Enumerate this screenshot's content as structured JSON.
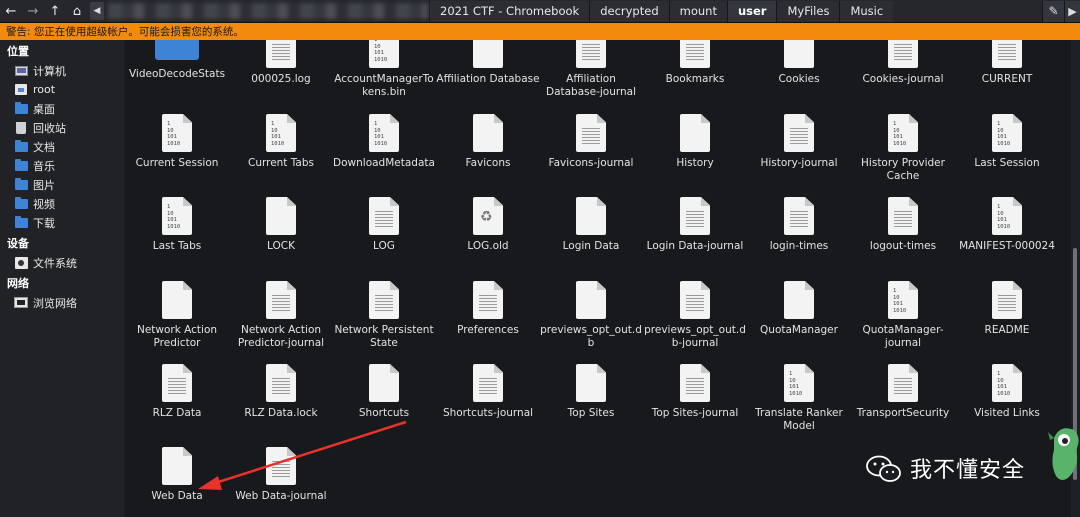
{
  "toolbar": {
    "back_icon": "arrow-left",
    "forward_icon": "arrow-right",
    "up_icon": "arrow-up",
    "home_icon": "home",
    "toggle_icon": "chevron-left",
    "breadcrumbs": [
      "2021 CTF - Chromebook",
      "decrypted",
      "mount",
      "user",
      "MyFiles",
      "Music"
    ],
    "active_crumb": "user",
    "edit_icon": "pencil",
    "menu_icon": "chevron-right"
  },
  "warning": {
    "text": "警告: 您正在使用超级帐户。可能会损害您的系统。",
    "color": "#f28a0e"
  },
  "sidebar": {
    "places_title": "位置",
    "places": [
      {
        "label": "计算机",
        "icon": "monitor-icon"
      },
      {
        "label": "root",
        "icon": "home-icon"
      },
      {
        "label": "桌面",
        "icon": "folder-icon"
      },
      {
        "label": "回收站",
        "icon": "trash-icon"
      },
      {
        "label": "文档",
        "icon": "folder-icon"
      },
      {
        "label": "音乐",
        "icon": "folder-icon"
      },
      {
        "label": "图片",
        "icon": "folder-icon"
      },
      {
        "label": "视频",
        "icon": "folder-icon"
      },
      {
        "label": "下载",
        "icon": "folder-icon"
      }
    ],
    "devices_title": "设备",
    "devices": [
      {
        "label": "文件系统",
        "icon": "drive-icon"
      }
    ],
    "network_title": "网络",
    "network": [
      {
        "label": "浏览网络",
        "icon": "network-icon"
      }
    ]
  },
  "files": [
    [
      "VideoDecodeStats",
      "000025.log",
      "AccountManagerTokens.bin",
      "Affiliation Database",
      "Affiliation Database-journal",
      "Bookmarks",
      "Cookies",
      "Cookies-journal",
      "CURRENT"
    ],
    [
      "Current Session",
      "Current Tabs",
      "DownloadMetadata",
      "Favicons",
      "Favicons-journal",
      "History",
      "History-journal",
      "History Provider Cache",
      "Last Session"
    ],
    [
      "Last Tabs",
      "LOCK",
      "LOG",
      "LOG.old",
      "Login Data",
      "Login Data-journal",
      "login-times",
      "logout-times",
      "MANIFEST-000024"
    ],
    [
      "Network Action Predictor",
      "Network Action Predictor-journal",
      "Network Persistent State",
      "Preferences",
      "previews_opt_out.db",
      "previews_opt_out.db-journal",
      "QuotaManager",
      "QuotaManager-journal",
      "README"
    ],
    [
      "RLZ Data",
      "RLZ Data.lock",
      "Shortcuts",
      "Shortcuts-journal",
      "Top Sites",
      "Top Sites-journal",
      "Translate Ranker Model",
      "TransportSecurity",
      "Visited Links"
    ],
    [
      "Web Data",
      "Web Data-journal"
    ]
  ],
  "file_labels_wrapped": {
    "AccountManagerTokens.bin": "AccountManagerTo\nkens.bin",
    "Affiliation Database-journal": "Affiliation\nDatabase-journal",
    "History Provider Cache": "History Provider\nCache",
    "Network Action Predictor": "Network Action\nPredictor",
    "Network Action Predictor-journal": "Network Action\nPredictor-journal",
    "Network Persistent State": "Network Persistent\nState",
    "previews_opt_out.db": "previews_opt_out.d\nb",
    "previews_opt_out.db-journal": "previews_opt_out.d\nb-journal",
    "QuotaManager-journal": "QuotaManager-\njournal",
    "Translate Ranker Model": "Translate Ranker\nModel"
  },
  "icon_types": {
    "VideoDecodeStats": "folder",
    "000025.log": "text",
    "AccountManagerTokens.bin": "binary",
    "Affiliation Database": "blank",
    "Affiliation Database-journal": "text",
    "Bookmarks": "text",
    "Cookies": "blank",
    "Cookies-journal": "text",
    "CURRENT": "text",
    "Current Session": "binary",
    "Current Tabs": "binary",
    "DownloadMetadata": "binary",
    "Favicons": "blank",
    "Favicons-journal": "text",
    "History": "blank",
    "History-journal": "text",
    "History Provider Cache": "binary",
    "Last Session": "binary",
    "Last Tabs": "binary",
    "LOCK": "blank",
    "LOG": "text",
    "LOG.old": "recycle",
    "Login Data": "blank",
    "Login Data-journal": "text",
    "login-times": "text",
    "logout-times": "text",
    "MANIFEST-000024": "binary",
    "Network Action Predictor": "blank",
    "Network Action Predictor-journal": "text",
    "Network Persistent State": "text",
    "Preferences": "text",
    "previews_opt_out.db": "blank",
    "previews_opt_out.db-journal": "text",
    "QuotaManager": "blank",
    "QuotaManager-journal": "binary",
    "README": "text",
    "RLZ Data": "text",
    "RLZ Data.lock": "text",
    "Shortcuts": "blank",
    "Shortcuts-journal": "text",
    "Top Sites": "blank",
    "Top Sites-journal": "text",
    "Translate Ranker Model": "binary",
    "TransportSecurity": "text",
    "Visited Links": "binary",
    "Web Data": "blank",
    "Web Data-journal": "text"
  },
  "watermark": {
    "text": "我不懂安全",
    "icon": "wechat-icon"
  },
  "annotation": {
    "arrow_color": "#e8322b"
  }
}
